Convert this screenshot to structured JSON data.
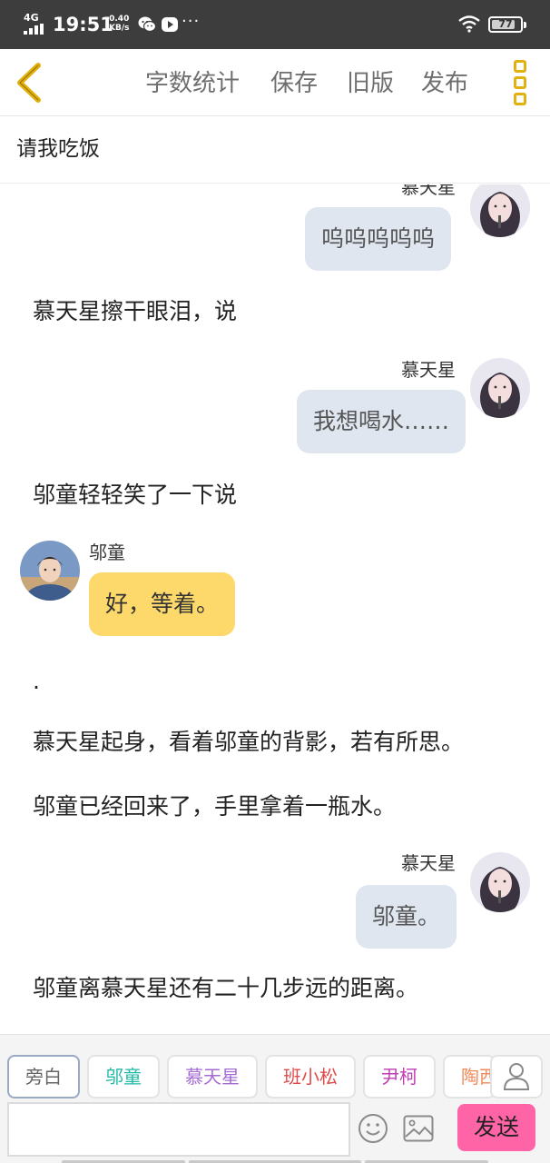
{
  "status_bar": {
    "network": "4G",
    "time": "19:51",
    "speed_value": "0.40",
    "speed_unit": "KB/s",
    "more": "···",
    "battery": "77"
  },
  "header": {
    "back_icon": "chevron-left-icon",
    "buttons": [
      "字数统计",
      "保存",
      "旧版",
      "发布"
    ],
    "menu_icon": "menu-icon",
    "accent": "#e2b10f"
  },
  "title": "请我吃饭",
  "chat": {
    "speaker_female": "慕天星",
    "speaker_male": "邬童",
    "top_bubble": "呜呜呜呜呜",
    "narration_1": "慕天星擦干眼泪，说",
    "bubble_2": "我想喝水……",
    "narration_2": "邬童轻轻笑了一下说",
    "bubble_3": "好，等着。",
    "dot": ".",
    "narration_3": "慕天星起身，看着邬童的背影，若有所思。",
    "narration_4": "邬童已经回来了，手里拿着一瓶水。",
    "bubble_4": "邬童。",
    "narration_5": "邬童离慕天星还有二十几步远的距离。"
  },
  "bottom_bar": {
    "chips": [
      "旁白",
      "邬童",
      "慕天星",
      "班小松",
      "尹柯",
      "陶西"
    ],
    "chip_colors": [
      "#666666",
      "#21b9a8",
      "#a46cd3",
      "#e04a4a",
      "#c13cb5",
      "#f08a5a"
    ],
    "input_placeholder": "",
    "send_label": "发送",
    "send_color": "#ff64a6"
  }
}
